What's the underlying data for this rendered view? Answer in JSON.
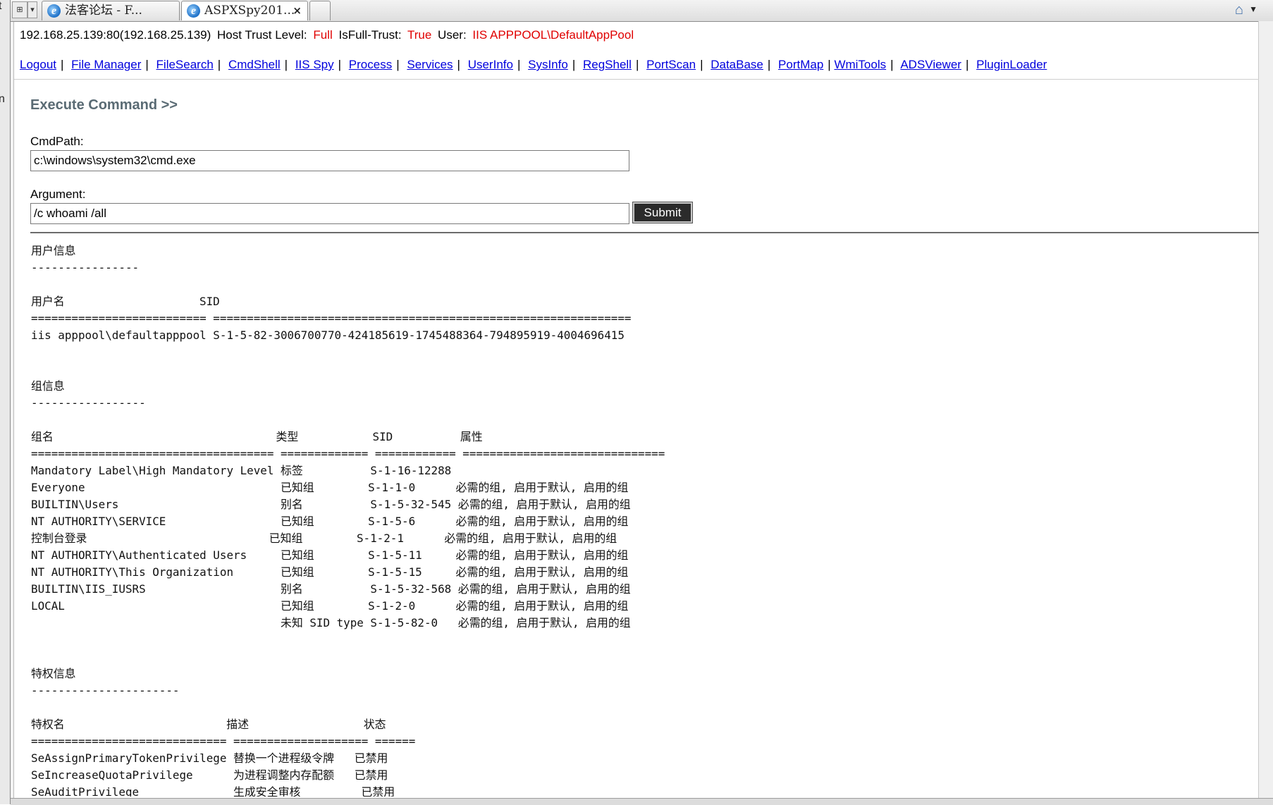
{
  "browser": {
    "tabs": [
      {
        "title": "法客论坛 - F...",
        "active": false,
        "icon": "ie-icon"
      },
      {
        "title": "ASPXSpy201...",
        "active": true,
        "icon": "ie-icon",
        "closable": true
      }
    ],
    "home_icon": "home-icon"
  },
  "gutter_fragments": [
    "t",
    "n"
  ],
  "info": {
    "host": "192.168.25.139:80(192.168.25.139)",
    "trust_label": "Host Trust Level:",
    "trust_value": "Full",
    "full_trust_label": "IsFull-Trust:",
    "full_trust_value": "True",
    "user_label": "User:",
    "user_value": "IIS APPPOOL\\DefaultAppPool",
    "accent_color": "#e00000"
  },
  "nav": {
    "links": [
      "Logout",
      "File Manager",
      "FileSearch",
      "CmdShell",
      "IIS Spy",
      "Process",
      "Services",
      "UserInfo",
      "SysInfo",
      "RegShell",
      "PortScan",
      "DataBase",
      "PortMap",
      "WmiTools",
      "ADSViewer",
      "PluginLoader"
    ],
    "link_color": "#0000dd"
  },
  "exec": {
    "title": "Execute Command >>",
    "cmdpath_label": "CmdPath:",
    "cmdpath_value": "c:\\windows\\system32\\cmd.exe",
    "argument_label": "Argument:",
    "argument_value": "/c whoami /all",
    "submit_label": "Submit"
  },
  "output_lines": [
    "用户信息",
    "----------------",
    "",
    "用户名                    SID",
    "========================== ==============================================================",
    "iis apppool\\defaultapppool S-1-5-82-3006700770-424185619-1745488364-794895919-4004696415",
    "",
    "",
    "组信息",
    "-----------------",
    "",
    "组名                                 类型           SID          属性",
    "==================================== ============= ============ ==============================",
    "Mandatory Label\\High Mandatory Level 标签          S-1-16-12288",
    "Everyone                             已知组        S-1-1-0      必需的组, 启用于默认, 启用的组",
    "BUILTIN\\Users                        别名          S-1-5-32-545 必需的组, 启用于默认, 启用的组",
    "NT AUTHORITY\\SERVICE                 已知组        S-1-5-6      必需的组, 启用于默认, 启用的组",
    "控制台登录                           已知组        S-1-2-1      必需的组, 启用于默认, 启用的组",
    "NT AUTHORITY\\Authenticated Users     已知组        S-1-5-11     必需的组, 启用于默认, 启用的组",
    "NT AUTHORITY\\This Organization       已知组        S-1-5-15     必需的组, 启用于默认, 启用的组",
    "BUILTIN\\IIS_IUSRS                    别名          S-1-5-32-568 必需的组, 启用于默认, 启用的组",
    "LOCAL                                已知组        S-1-2-0      必需的组, 启用于默认, 启用的组",
    "                                     未知 SID type S-1-5-82-0   必需的组, 启用于默认, 启用的组",
    "",
    "",
    "特权信息",
    "----------------------",
    "",
    "特权名                        描述                 状态",
    "============================= ==================== ======",
    "SeAssignPrimaryTokenPrivilege 替换一个进程级令牌   已禁用",
    "SeIncreaseQuotaPrivilege      为进程调整内存配额   已禁用",
    "SeAuditPrivilege              生成安全审核         已禁用"
  ]
}
